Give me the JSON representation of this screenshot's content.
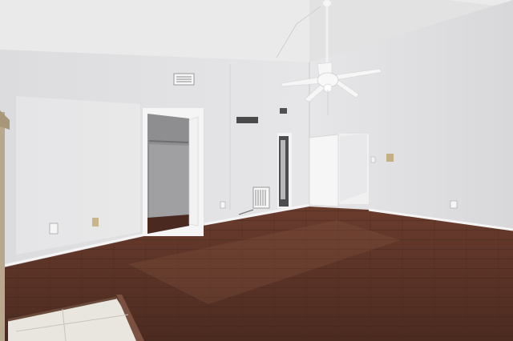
{
  "scene": {
    "description_visible_text": "",
    "colors": {
      "wall": "#e4e4e6",
      "wall_shadow": "#cfd0d2",
      "ceiling": "#ececec",
      "floor": "#5a3428",
      "floor_light": "#7a4a3a",
      "tile": "#e8e6e1",
      "trim": "#f4f4f4"
    }
  }
}
